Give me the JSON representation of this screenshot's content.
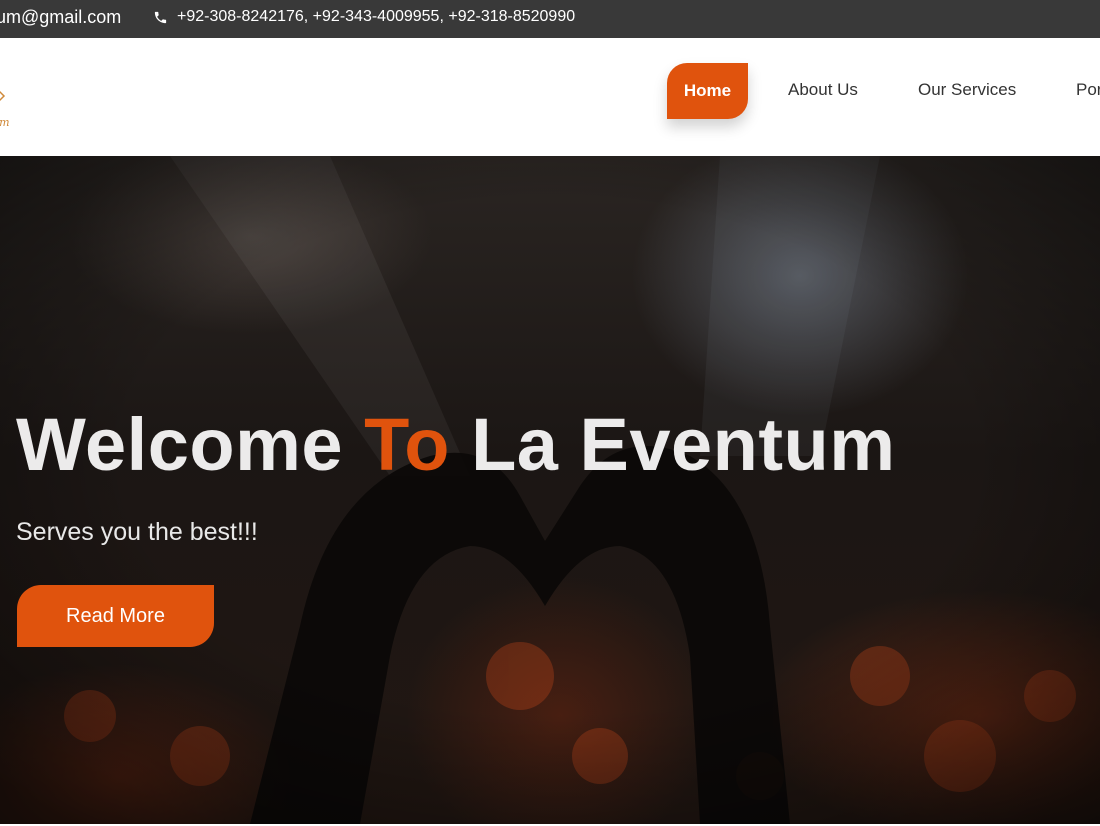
{
  "topbar": {
    "email": "um@gmail.com",
    "phones": "+92-308-8242176, +92-343-4009955, +92-318-8520990",
    "phone_icon": "phone-icon"
  },
  "nav": {
    "items": [
      {
        "label": "Home",
        "active": true
      },
      {
        "label": "About Us",
        "active": false
      },
      {
        "label": "Our Services",
        "active": false
      },
      {
        "label": "Por",
        "active": false
      }
    ]
  },
  "logo": {
    "script_text": "um"
  },
  "hero": {
    "title_part1": "Welcome ",
    "title_accent": "To",
    "title_part2": " La Eventum",
    "subtitle": "Serves you the best!!!",
    "button_label": "Read More"
  },
  "colors": {
    "accent": "#e0530d",
    "topbar_bg": "#393939",
    "hero_text": "#ecebeb"
  }
}
